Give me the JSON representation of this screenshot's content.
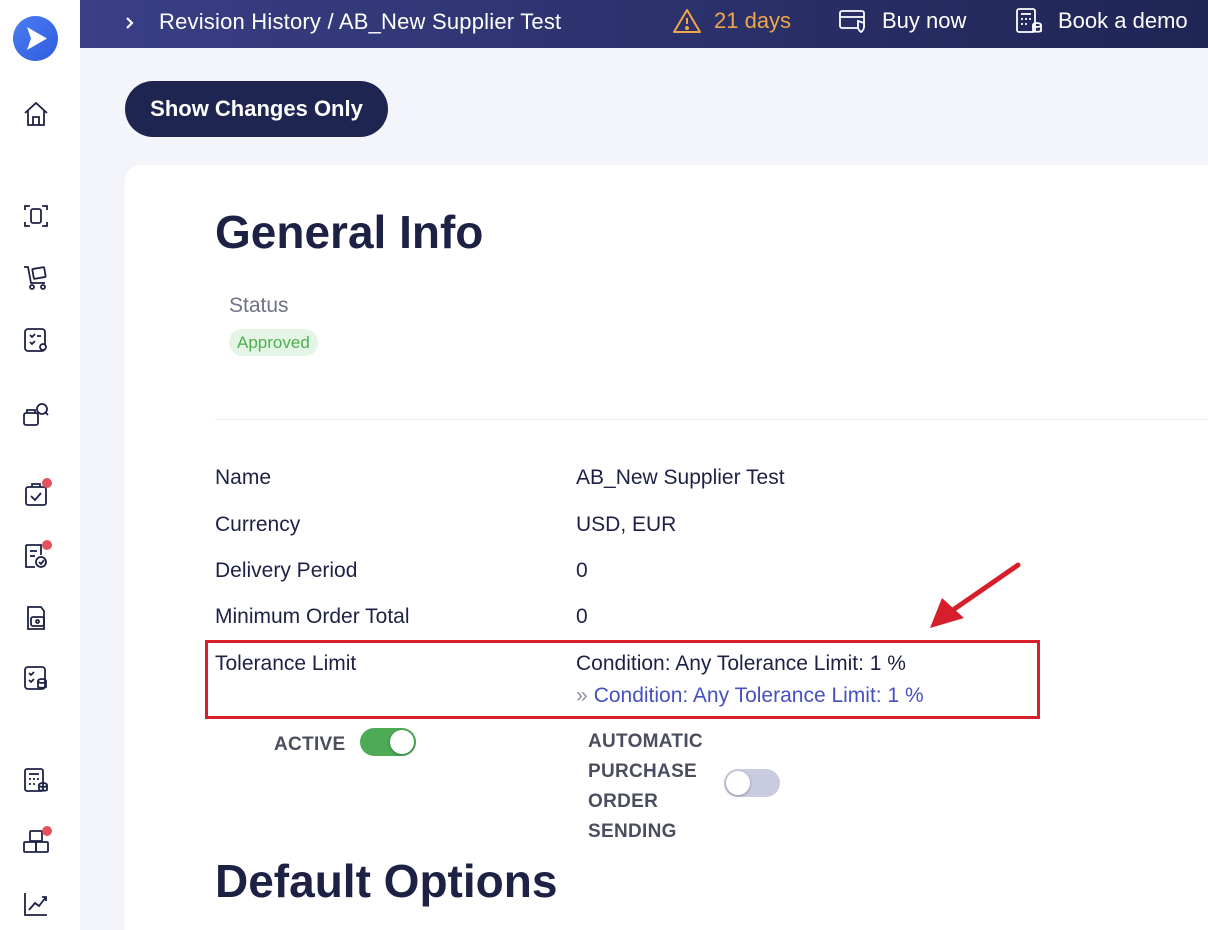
{
  "topbar": {
    "breadcrumb": "Revision History / AB_New Supplier Test",
    "trial_days": "21 days",
    "buy_now": "Buy now",
    "book_demo": "Book a demo"
  },
  "toolbar": {
    "show_changes_label": "Show Changes Only"
  },
  "general": {
    "title": "General Info",
    "status_label": "Status",
    "status_value": "Approved",
    "rows": [
      {
        "label": "Name",
        "value": "AB_New Supplier Test"
      },
      {
        "label": "Currency",
        "value": "USD, EUR"
      },
      {
        "label": "Delivery Period",
        "value": "0"
      },
      {
        "label": "Minimum Order Total",
        "value": "0"
      },
      {
        "label": "Tolerance Limit",
        "value": "Condition: Any Tolerance Limit: 1 %",
        "new_value": "Condition: Any Tolerance Limit: 1 %"
      }
    ],
    "change_marker": "»",
    "active_label": "ACTIVE",
    "auto_po_label_lines": [
      "AUTOMATIC",
      "PURCHASE",
      "ORDER",
      "SENDING"
    ]
  },
  "default_options": {
    "title": "Default Options"
  },
  "toggles": {
    "active": true,
    "automatic_po_sending": false
  },
  "colors": {
    "topbar": "#2a3070",
    "primary_button": "#1e2550",
    "trial_warning": "#f0a64a",
    "status_approved": "#4caf50",
    "changed_value": "#4650c0",
    "highlight": "#d71f2b",
    "toggle_on": "#4cab54"
  },
  "icons": {
    "sidebar": [
      "home-icon",
      "scan-icon",
      "cart-icon",
      "supplier-list-icon",
      "supplier-search-icon",
      "approval-bag-icon",
      "invoice-check-icon",
      "payment-icon",
      "catalog-icon",
      "budget-calculator-icon",
      "inventory-boxes-icon",
      "analytics-icon"
    ]
  }
}
